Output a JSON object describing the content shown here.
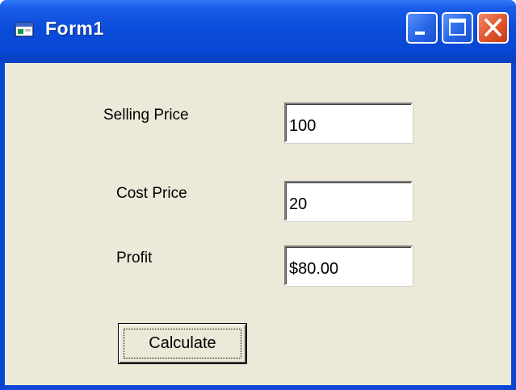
{
  "window": {
    "title": "Form1",
    "icon": "form-icon",
    "buttons": [
      "minimize-icon",
      "maximize-icon",
      "close-icon"
    ]
  },
  "form": {
    "selling_price_label": "Selling Price",
    "selling_price_value": "100",
    "cost_price_label": "Cost Price",
    "cost_price_value": "20",
    "profit_label": "Profit",
    "profit_value": "$80.00",
    "calculate_label": "Calculate"
  },
  "colors": {
    "titlebar": "#0b4ddb",
    "client_background": "#ece9d8",
    "close_button": "#e2542c"
  }
}
